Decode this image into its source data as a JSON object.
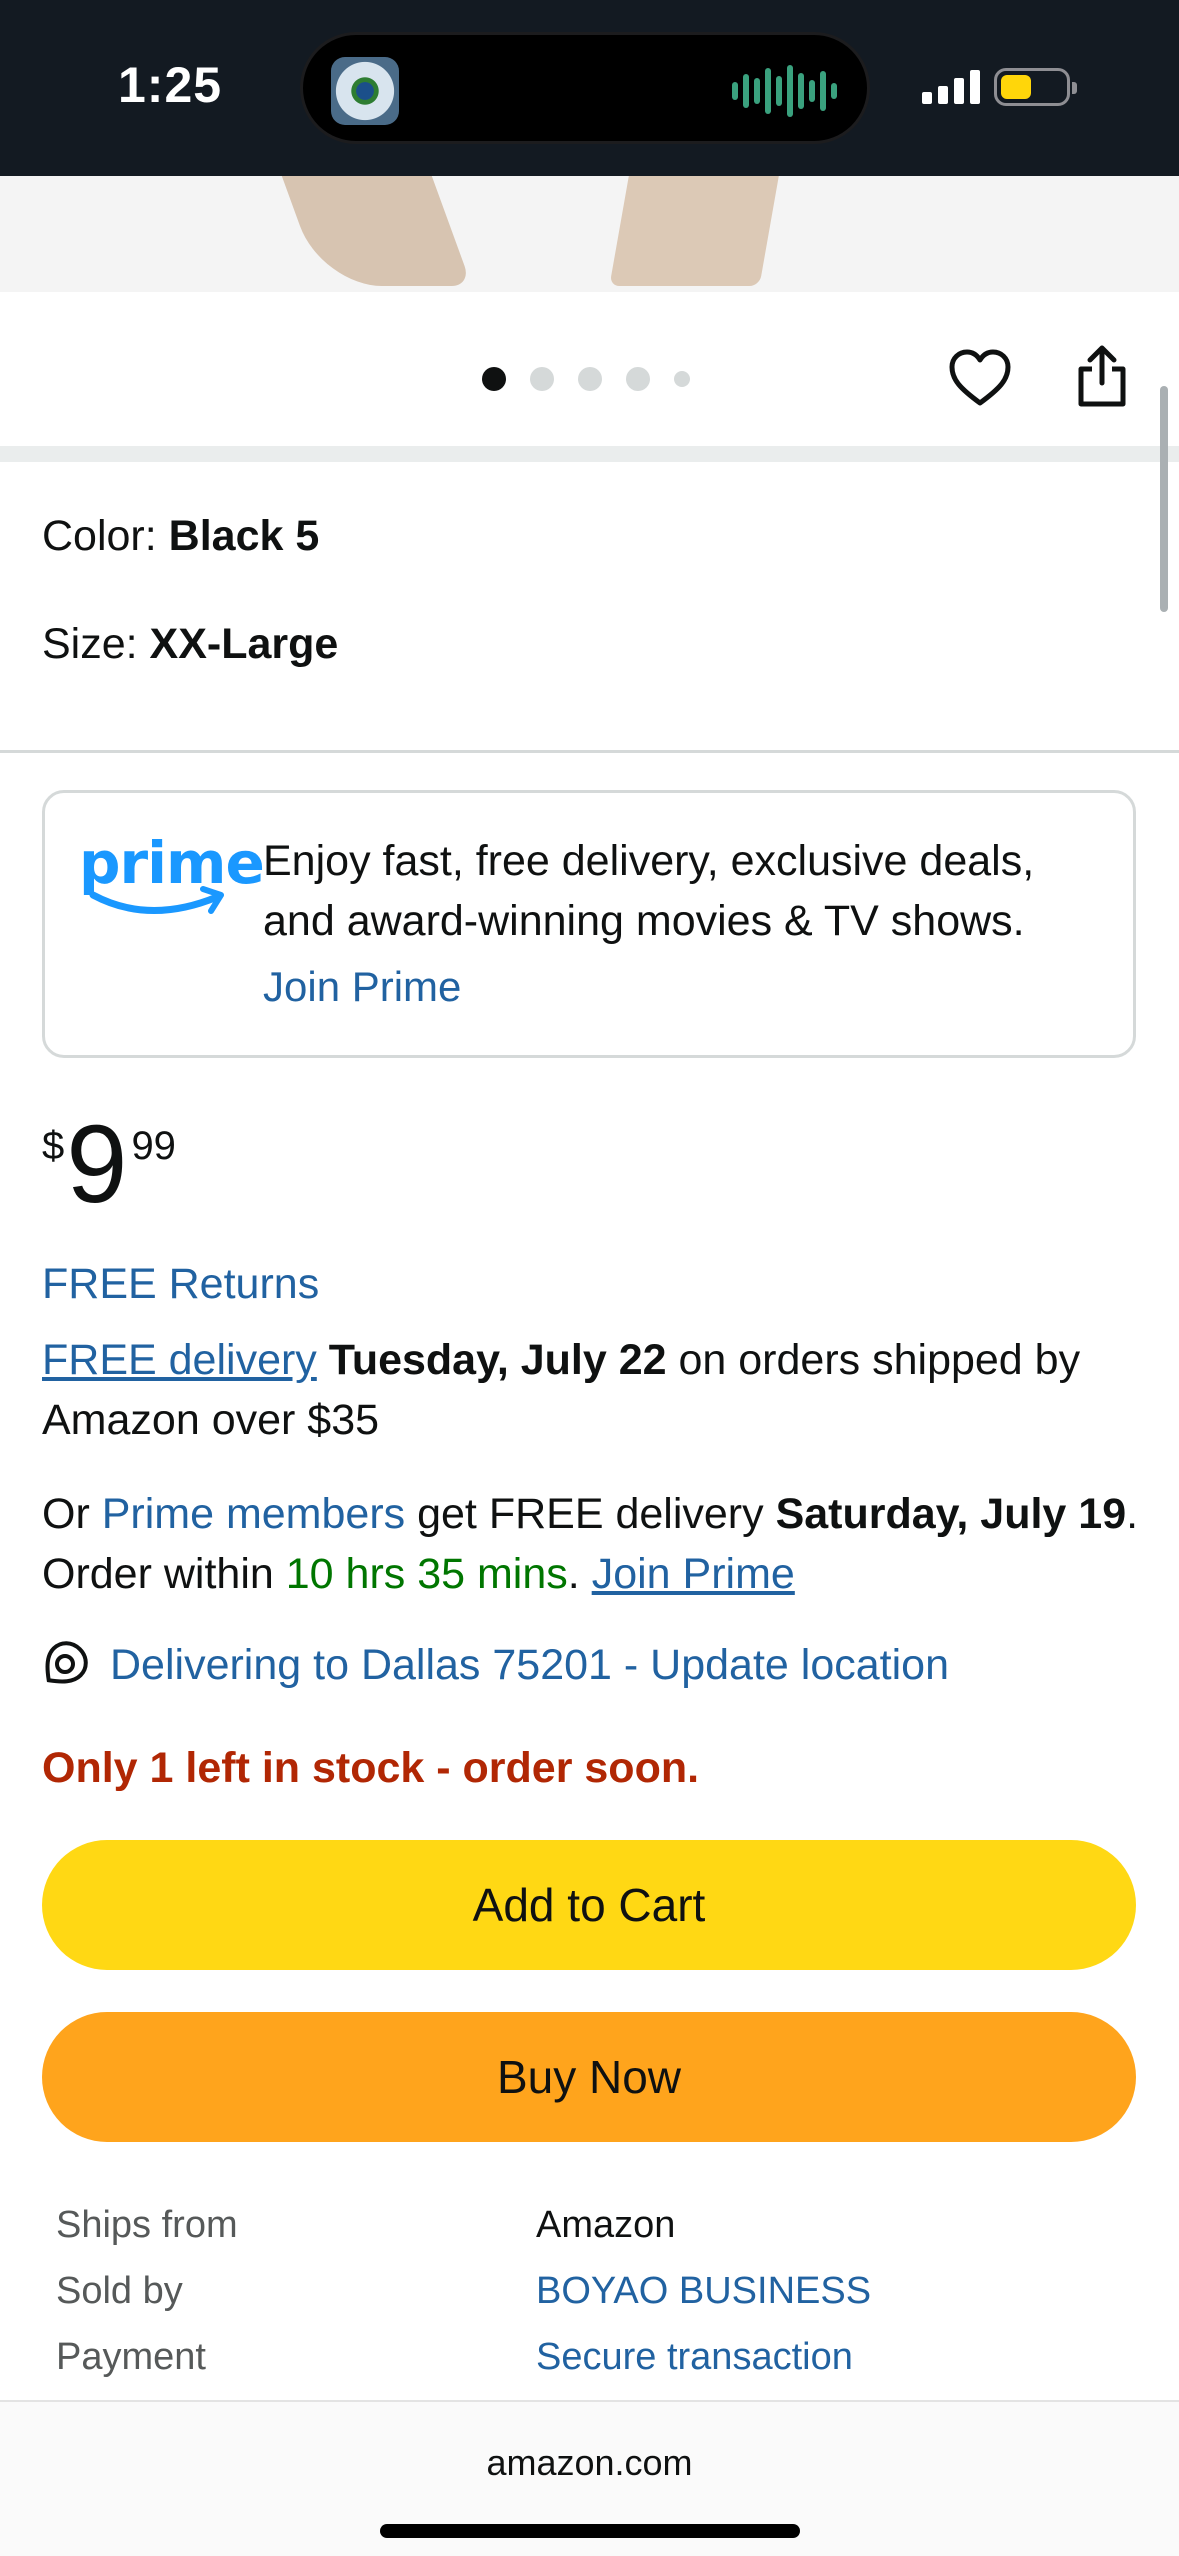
{
  "status_bar": {
    "time": "1:25",
    "battery_color": "#ffd60a"
  },
  "carousel": {
    "dot_count": 5,
    "active_index": 0
  },
  "variations": {
    "color_label": "Color: ",
    "color_value": "Black 5",
    "size_label": "Size: ",
    "size_value": "XX-Large"
  },
  "prime_box": {
    "logo_text": "prime",
    "message": "Enjoy fast, free delivery, exclusive deals, and award-winning movies & TV shows.",
    "join_link": "Join Prime"
  },
  "price": {
    "symbol": "$",
    "whole": "9",
    "fraction": "99"
  },
  "free_returns": "FREE Returns",
  "delivery": {
    "link": "FREE delivery",
    "date": "Tuesday, July 22",
    "rest": " on orders shipped by Amazon over $35"
  },
  "prime_delivery": {
    "prefix": "Or ",
    "members_link": "Prime members",
    "mid": " get FREE delivery ",
    "date": "Saturday, July 19",
    "order_within": ". Order within ",
    "countdown": "10 hrs 35 mins",
    "dot": ". ",
    "join_link": "Join Prime"
  },
  "location": "Delivering to Dallas 75201 - Update location",
  "stock": "Only 1 left in stock - order soon.",
  "buttons": {
    "add_to_cart": "Add to Cart",
    "buy_now": "Buy Now"
  },
  "details": {
    "ships_from_label": "Ships from",
    "ships_from_value": "Amazon",
    "sold_by_label": "Sold by",
    "sold_by_value": "BOYAO BUSINESS",
    "payment_label": "Payment",
    "payment_value": "Secure transaction"
  },
  "browser": {
    "url": "amazon.com"
  },
  "colors": {
    "link": "#2162a1",
    "add_to_cart": "#ffd814",
    "buy_now": "#ffa41c",
    "stock_warning": "#b12704",
    "countdown": "#007600"
  }
}
